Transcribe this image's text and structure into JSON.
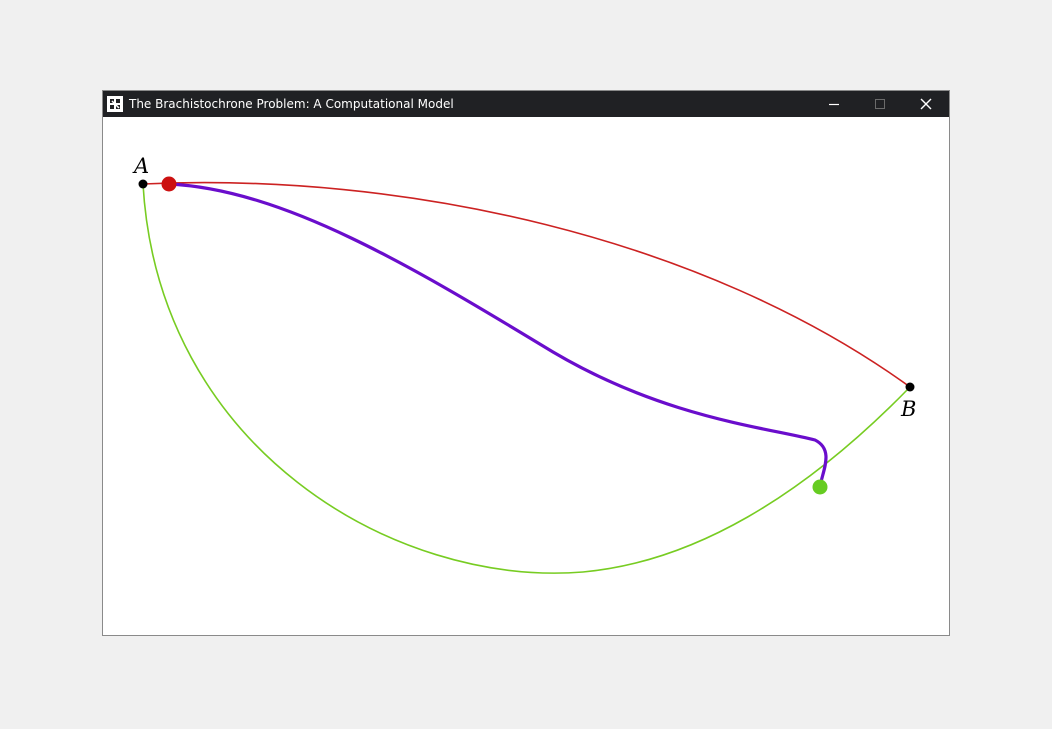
{
  "window": {
    "title": "The Brachistochrone Problem: A Computational Model",
    "controls": [
      "minimize-icon",
      "maximize-icon",
      "close-icon"
    ]
  },
  "canvas": {
    "point_a_label": "A",
    "point_b_label": "B",
    "colors": {
      "red_curve": "#cc2222",
      "purple_curve": "#6a0dcc",
      "green_curve": "#77cc22",
      "red_marker": "#cc1111",
      "green_marker": "#66cc22",
      "endpoint": "#000000"
    }
  }
}
